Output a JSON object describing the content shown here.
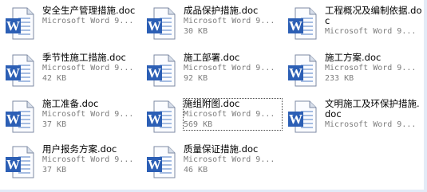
{
  "files": [
    {
      "name": "安全生产管理措施.doc",
      "type": "Microsoft Word 9...",
      "size": ""
    },
    {
      "name": "成品保护措施.doc",
      "type": "Microsoft Word 9...",
      "size": "30 KB"
    },
    {
      "name": "工程概况及编制依据.doc",
      "type": "Microsoft Word 9...",
      "size": ""
    },
    {
      "name": "季节性施工措施.doc",
      "type": "Microsoft Word 9...",
      "size": "42 KB"
    },
    {
      "name": "施工部署.doc",
      "type": "Microsoft Word 9...",
      "size": "92 KB"
    },
    {
      "name": "施工方案.doc",
      "type": "Microsoft Word 9...",
      "size": "233 KB"
    },
    {
      "name": "施工准备.doc",
      "type": "Microsoft Word 9...",
      "size": "37 KB"
    },
    {
      "name": "施组附图.doc",
      "type": "Microsoft Word 9...",
      "size": "569 KB"
    },
    {
      "name": "文明施工及环保护措施.doc",
      "type": "Microsoft Word 9...",
      "size": ""
    },
    {
      "name": "用户报务方案.doc",
      "type": "Microsoft Word 9...",
      "size": "37 KB"
    },
    {
      "name": "质量保证措施.doc",
      "type": "Microsoft Word 9...",
      "size": "46 KB"
    }
  ],
  "icon": {
    "name": "word-document-icon",
    "letter": "W",
    "accent": "#2c5fb5"
  }
}
